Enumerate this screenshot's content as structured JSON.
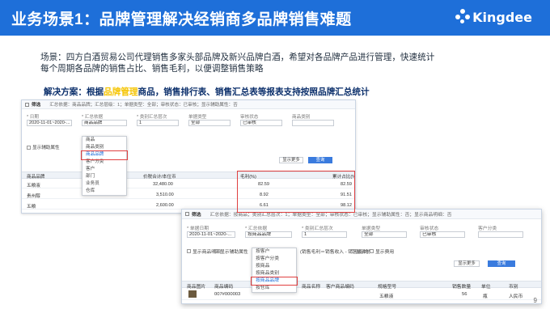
{
  "header": {
    "title": "业务场景1：品牌管理解决经销商多品牌销售难题",
    "logo_text": "Kingdee"
  },
  "description": {
    "line1": "场景：四方白酒贸易公司代理销售多家头部品牌及新兴品牌白酒，希望对各品牌产品进行管理，快速统计",
    "line2": "每个周期各品牌的销售占比、销售毛利，以便调整销售策略"
  },
  "solution": {
    "prefix": "解决方案：根据",
    "highlight": "品牌管理",
    "suffix": "商品，销售排行表、销售汇总表等报表支持按照品牌汇总统计"
  },
  "panel1": {
    "filter_label": "筛选",
    "filter_summary": "汇总依据：商品品牌；汇总层级：1；单据类型：全部；审核状态：已审核；显示辅助属性：否",
    "fields": {
      "date_label": "* 日期",
      "date_value": "2020-11-01~2020-...",
      "basis_label": "* 汇总依据",
      "basis_value": "商品品牌",
      "level_label": "* 类别汇总层次",
      "level_value": "1",
      "type_label": "单据类型",
      "type_value": "全部",
      "status_label": "审核状态",
      "status_value": "已审核",
      "category_label": "商品类别",
      "category_value": ""
    },
    "dropdown_options": [
      "商品",
      "商品类别",
      "商品品牌",
      "客户分类",
      "客户",
      "部门",
      "业务员",
      "仓库"
    ],
    "checkbox_label": "显示辅助属性",
    "btn_more": "显示更多",
    "btn_query": "查询",
    "table": {
      "headers": [
        "商品品牌",
        "价税合计/本位币",
        "毛利率",
        "毛利(%)",
        "累计占比(%)"
      ],
      "rows": [
        {
          "brand": "五粮液",
          "amount": "32,480.00",
          "pct": "82.59",
          "cum": "82.59"
        },
        {
          "brand": "贵州醇",
          "amount": "3,510.00",
          "pct": "8.92",
          "cum": "91.51"
        },
        {
          "brand": "五粮",
          "amount": "2,600.00",
          "pct": "6.61",
          "cum": "98.12"
        }
      ]
    }
  },
  "panel2": {
    "filter_label": "筛选",
    "filter_summary": "汇总依据：按商品；类别汇总层次：1；单据类型：全部；审核状态：已审核；显示辅助属性：否；显示商品明细：否",
    "fields": {
      "date_label": "* 单据日期",
      "date_value": "2020-11-01~2020-...",
      "basis_label": "* 汇总依据",
      "basis_value": "按商品品牌",
      "level_label": "* 类别汇总层次",
      "level_value": "1",
      "type_label": "单据类型",
      "type_value": "全部",
      "status_label": "审核状态",
      "status_value": "已审核",
      "customer_label": "客户分类",
      "customer_value": ""
    },
    "dropdown_options": [
      "按客户",
      "按客户分类",
      "按商品",
      "按商品类别",
      "按商品品牌",
      "按仓库"
    ],
    "checkboxes": [
      "显示商品明细",
      "显示辅助属性",
      "(销售毛利＝销售收入 - 销售成本)",
      "显示税",
      "显示费用"
    ],
    "btn_more": "显示更多",
    "btn_query": "查询",
    "table": {
      "headers": [
        "商品图片",
        "商品编码",
        "商品名称",
        "客户商品编码",
        "规格型号",
        "销售数量",
        "单位",
        "币别"
      ],
      "row": {
        "code": "007#000003",
        "name": "五粮液",
        "qty": "56",
        "unit": "瓶",
        "currency": "人民币"
      }
    }
  },
  "page_number": "9"
}
